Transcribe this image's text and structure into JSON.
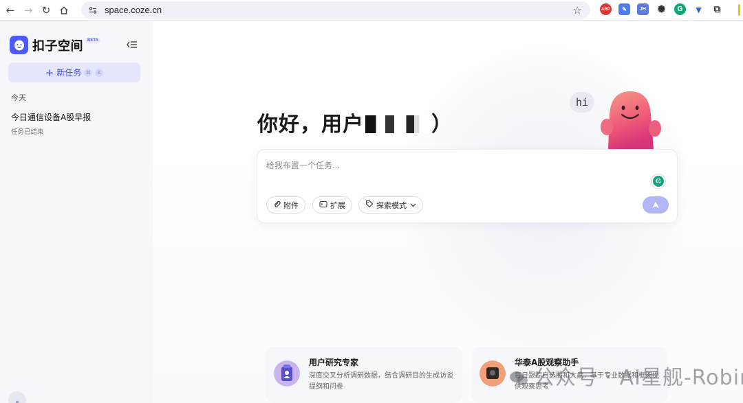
{
  "browser": {
    "url": "space.coze.cn",
    "extensions": [
      "ABP",
      "JH",
      "G"
    ]
  },
  "sidebar": {
    "app_name": "扣子空间",
    "beta_badge": "BETA",
    "new_task_label": "新任务",
    "new_task_shortcut_1": "⌘",
    "new_task_shortcut_2": "K",
    "section_today": "今天",
    "tasks": [
      {
        "title": "今日通信设备A股早报",
        "status": "任务已结束"
      }
    ]
  },
  "main": {
    "greeting": "你好，用户",
    "greeting_suffix": "）",
    "mascot_bubble": "hi",
    "input": {
      "placeholder": "给我布置一个任务..."
    },
    "chips": {
      "attach": "附件",
      "extend": "扩展",
      "mode": "探索模式"
    },
    "agents": [
      {
        "name": "用户研究专家",
        "desc": "深度交叉分析调研数据，结合调研目的生成访谈提纲和问卷"
      },
      {
        "name": "华泰A股观察助手",
        "desc": "每日跟踪自选股和大盘，基于专业数据和框架提供观察思考"
      }
    ]
  },
  "watermark": {
    "text": "公众号 · AI星舰-Robin"
  },
  "colors": {
    "accent": "#4e5cf7",
    "sidebar_bg": "#f6f7fa",
    "send_disabled": "#b3b6f4"
  }
}
